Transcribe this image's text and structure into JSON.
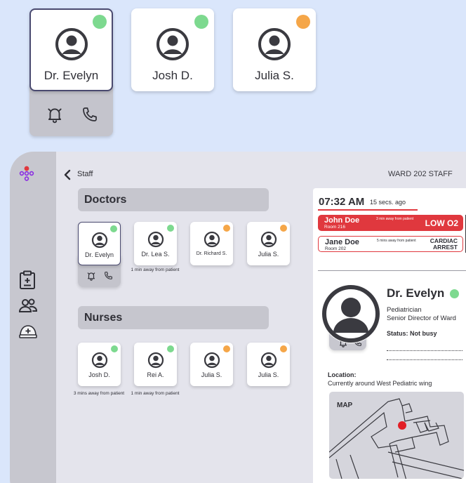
{
  "colors": {
    "background": "#dae6fb",
    "available": "#7dd98f",
    "busy": "#f5a648",
    "alert_red": "#e0383e",
    "map_marker": "#e21f26",
    "app_logo": "#8a2be2"
  },
  "top_cards": [
    {
      "name": "Dr. Evelyn",
      "status": "available",
      "selected": true
    },
    {
      "name": "Josh D.",
      "status": "available"
    },
    {
      "name": "Julia S.",
      "status": "busy"
    }
  ],
  "icons": {
    "bell": "bell-icon",
    "phone": "phone-icon",
    "avatar": "avatar-icon",
    "back": "chevron-left-icon",
    "clipboard": "clipboard-icon",
    "people": "people-icon",
    "nurse": "nurse-cap-icon"
  },
  "nav": {
    "back_label": "Staff",
    "title": "WARD 202 STAFF"
  },
  "doctors": {
    "heading": "Doctors",
    "items": [
      {
        "name": "Dr. Evelyn",
        "status": "available",
        "selected": true,
        "caption": ""
      },
      {
        "name": "Dr. Lea S.",
        "status": "available",
        "caption": "1 min away from patient"
      },
      {
        "name": "Dr. Richard S.",
        "status": "busy",
        "caption": ""
      },
      {
        "name": "Julia S.",
        "status": "busy",
        "caption": ""
      }
    ]
  },
  "nurses": {
    "heading": "Nurses",
    "items": [
      {
        "name": "Josh D.",
        "status": "available",
        "caption": "3 mins away from patient"
      },
      {
        "name": "Rei A.",
        "status": "available",
        "caption": "1 min away from patient"
      },
      {
        "name": "Julia S.",
        "status": "busy",
        "caption": ""
      },
      {
        "name": "Julia S.",
        "status": "busy",
        "caption": ""
      }
    ]
  },
  "alerts_panel": {
    "time": "07:32 AM",
    "ago": "15 secs. ago",
    "alerts": [
      {
        "patient": "John Doe",
        "room": "Room 216",
        "away": "3 min away from patient",
        "status": "LOW O2",
        "style": "filled"
      },
      {
        "patient": "Jane Doe",
        "room": "Room 202",
        "away": "5 mins away from patient",
        "status": "CARDIAC ARREST",
        "style": "outline"
      }
    ]
  },
  "profile": {
    "name": "Dr. Evelyn",
    "role": "Pediatrician",
    "title": "Senior Director of Ward",
    "status_label": "Status: Not busy",
    "location_label": "Location:",
    "location": "Currently around West Pediatric wing",
    "map_label": "MAP"
  }
}
